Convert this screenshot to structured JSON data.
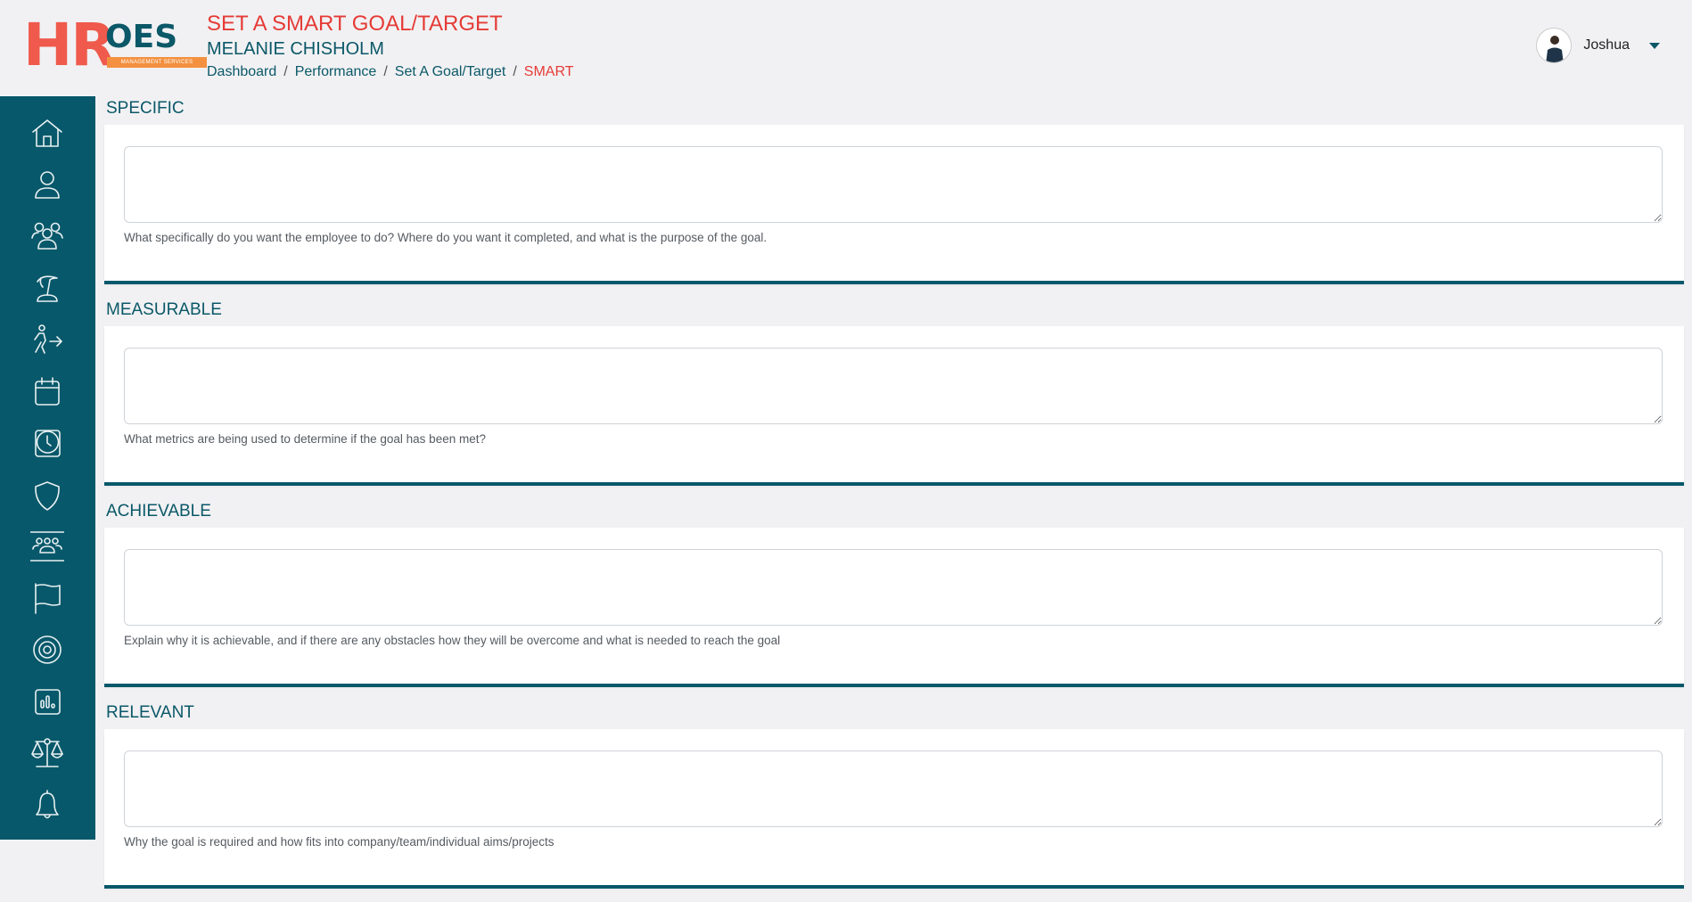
{
  "header": {
    "logo": {
      "hr": "HR",
      "oes": "OES",
      "tagline": "MANAGEMENT SERVICES"
    },
    "title": "SET A SMART GOAL/TARGET",
    "employee": "MELANIE CHISHOLM",
    "breadcrumb": [
      "Dashboard",
      "Performance",
      "Set A Goal/Target",
      "SMART"
    ],
    "user": {
      "name": "Joshua"
    }
  },
  "sidebar": {
    "icons": [
      "home-icon",
      "user-icon",
      "users-icon",
      "holiday-icon",
      "leaver-icon",
      "calendar-icon",
      "clock-icon",
      "shield-icon",
      "team-icon",
      "flag-icon",
      "target-icon",
      "report-icon",
      "scales-icon",
      "bell-icon"
    ]
  },
  "sections": [
    {
      "title": "SPECIFIC",
      "value": "",
      "help": "What specifically do you want the employee to do? Where do you want it completed, and what is the purpose of the goal."
    },
    {
      "title": "MEASURABLE",
      "value": "",
      "help": "What metrics are being used to determine if the goal has been met?"
    },
    {
      "title": "ACHIEVABLE",
      "value": "",
      "help": "Explain why it is achievable, and if there are any obstacles how they will be overcome and what is needed to reach the goal"
    },
    {
      "title": "RELEVANT",
      "value": "",
      "help": "Why the goal is required and how fits into company/team/individual aims/projects"
    }
  ],
  "colors": {
    "brand": "#07586a",
    "accent": "#e53b36",
    "logo_orange": "#f39140"
  }
}
